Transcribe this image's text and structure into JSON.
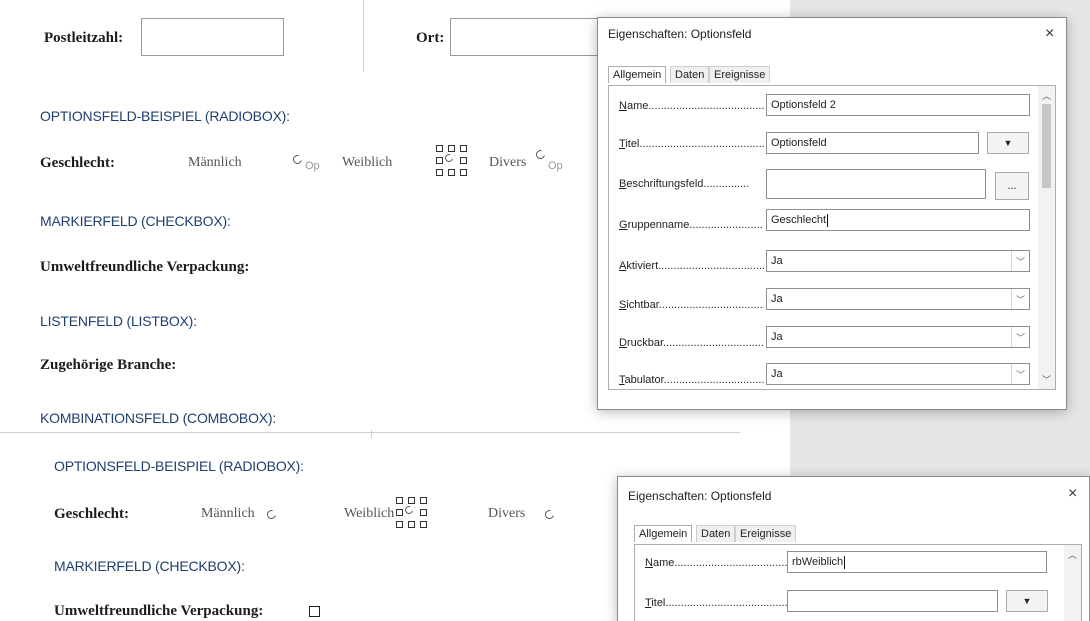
{
  "top_document": {
    "postal_label": "Postleitzahl:",
    "city_label": "Ort:",
    "radiobox_heading": "OPTIONSFELD-BEISPIEL (RADIOBOX):",
    "gender_label": "Geschlecht:",
    "option_male": "Männlich",
    "option_female": "Weiblich",
    "option_diverse": "Divers",
    "truncated_op_1": "Op",
    "truncated_op_2": "Op",
    "checkbox_heading": "MARKIERFELD (CHECKBOX):",
    "eco_label": "Umweltfreundliche Verpackung:",
    "listbox_heading": "LISTENFELD (LISTBOX):",
    "industry_label": "Zugehörige Branche:",
    "combobox_heading": "KOMBINATIONSFELD (COMBOBOX):"
  },
  "bottom_document": {
    "radiobox_heading": "OPTIONSFELD-BEISPIEL (RADIOBOX):",
    "gender_label": "Geschlecht:",
    "option_male": "Männlich",
    "option_female": "Weiblich",
    "option_diverse": "Divers",
    "checkbox_heading": "MARKIERFELD (CHECKBOX):",
    "eco_label": "Umweltfreundliche Verpackung:"
  },
  "dialog_top": {
    "title": "Eigenschaften: Optionsfeld",
    "close_glyph": "×",
    "tabs": [
      "Allgemein",
      "Daten",
      "Ereignisse"
    ],
    "properties": [
      {
        "label": "Name.........................................",
        "value": "Optionsfeld 2"
      },
      {
        "label": "Titel...........................................",
        "value": "Optionsfeld"
      },
      {
        "label": "Beschriftungsfeld...............",
        "value": ""
      },
      {
        "label": "Gruppenname........................",
        "value": "Geschlecht"
      },
      {
        "label": "Aktiviert...................................",
        "value": "Ja"
      },
      {
        "label": "Sichtbar.....................................",
        "value": "Ja"
      },
      {
        "label": "Druckbar...................................",
        "value": "Ja"
      },
      {
        "label": "Tabulator...................................",
        "value": "Ja"
      }
    ],
    "ellipsis_button": "..."
  },
  "dialog_bottom": {
    "title": "Eigenschaften: Optionsfeld",
    "close_glyph": "×",
    "tabs": [
      "Allgemein",
      "Daten",
      "Ereignisse"
    ],
    "properties": [
      {
        "label": "Name.........................................",
        "value": "rbWeiblich"
      },
      {
        "label": "Titel...........................................",
        "value": ""
      }
    ]
  },
  "icons": {
    "dropdown": "chevron-down-icon",
    "title_dropdown": "triangle-down-icon",
    "scroll_up": "chevron-up-icon",
    "scroll_down": "chevron-down-icon",
    "close": "close-icon"
  }
}
